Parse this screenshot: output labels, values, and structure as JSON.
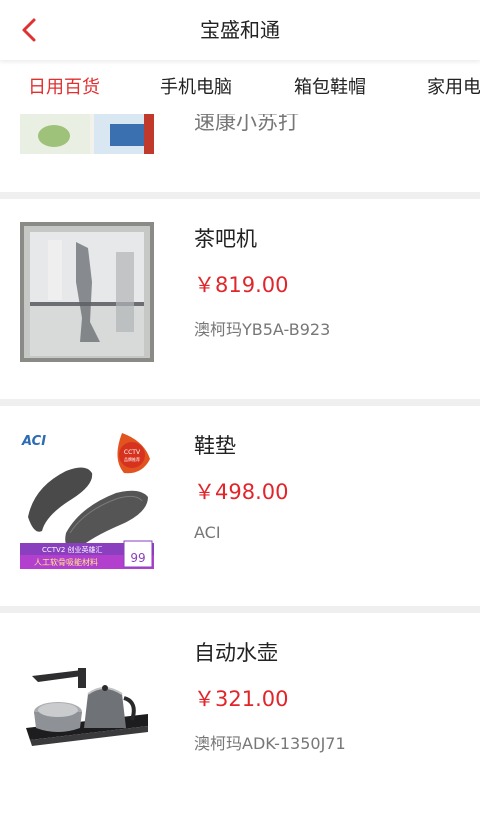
{
  "header": {
    "title": "宝盛和通",
    "back_icon": "chevron-left-icon",
    "accent": "#e0302f"
  },
  "tabs": [
    {
      "label": "日用百货",
      "active": true
    },
    {
      "label": "手机电脑",
      "active": false
    },
    {
      "label": "箱包鞋帽",
      "active": false
    },
    {
      "label": "家用电",
      "active": false
    }
  ],
  "products": [
    {
      "name": "速康小苏打",
      "price": "",
      "model": ""
    },
    {
      "name": "茶吧机",
      "price": "￥819.00",
      "model": "澳柯玛YB5A-B923"
    },
    {
      "name": "鞋垫",
      "price": "￥498.00",
      "model": "ACI"
    },
    {
      "name": "自动水壶",
      "price": "￥321.00",
      "model": "澳柯玛ADK-1350J71"
    }
  ],
  "image_text": {
    "insole_brand": "ACI",
    "insole_badge": "CCTV",
    "insole_badge_sub": "品牌推荐",
    "insole_banner": "CCTV2 创业英雄汇",
    "insole_banner2": "人工软骨吸能材料",
    "insole_price_tag": "99"
  },
  "colors": {
    "price": "#e0262b",
    "separator": "#efefef"
  }
}
